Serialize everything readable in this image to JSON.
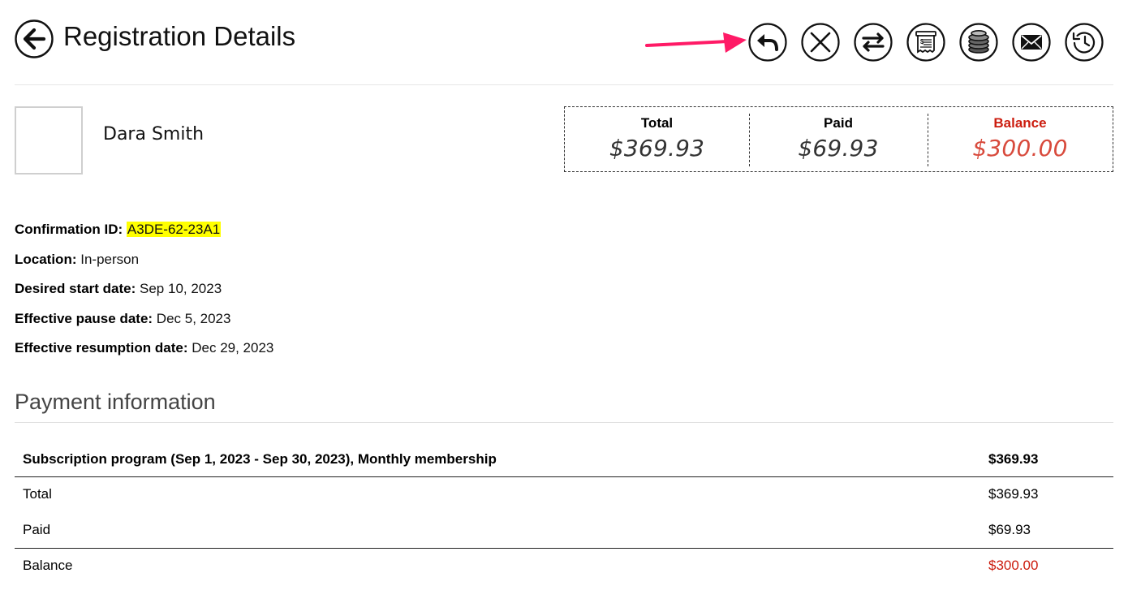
{
  "header": {
    "title": "Registration Details",
    "back_icon": "arrow-left-circle-icon",
    "actions": [
      {
        "name": "reply-icon",
        "label": "Reply"
      },
      {
        "name": "cancel-icon",
        "label": "Cancel"
      },
      {
        "name": "transfer-icon",
        "label": "Transfer"
      },
      {
        "name": "invoice-icon",
        "label": "Invoice"
      },
      {
        "name": "coins-icon",
        "label": "Payments"
      },
      {
        "name": "email-icon",
        "label": "Email"
      },
      {
        "name": "history-icon",
        "label": "History"
      }
    ],
    "annotation_arrow_color": "#ff1a66"
  },
  "member": {
    "name": "Dara Smith"
  },
  "summary": {
    "total_label": "Total",
    "total_value": "$369.93",
    "paid_label": "Paid",
    "paid_value": "$69.93",
    "balance_label": "Balance",
    "balance_value": "$300.00",
    "balance_color": "#cc1d0f"
  },
  "details": {
    "confirmation_label": "Confirmation ID:",
    "confirmation_value": "A3DE-62-23A1",
    "location_label": "Location:",
    "location_value": "In-person",
    "start_label": "Desired start date:",
    "start_value": "Sep 10, 2023",
    "pause_label": "Effective pause date:",
    "pause_value": "Dec 5, 2023",
    "resume_label": "Effective resumption date:",
    "resume_value": "Dec 29, 2023",
    "highlight_color": "#ffff00"
  },
  "payment": {
    "section_title": "Payment information",
    "item_label": "Subscription program (Sep 1, 2023 - Sep 30, 2023), Monthly membership",
    "item_amount": "$369.93",
    "rows": [
      {
        "label": "Total",
        "amount": "$369.93"
      },
      {
        "label": "Paid",
        "amount": "$69.93"
      },
      {
        "label": "Balance",
        "amount": "$300.00"
      }
    ]
  }
}
